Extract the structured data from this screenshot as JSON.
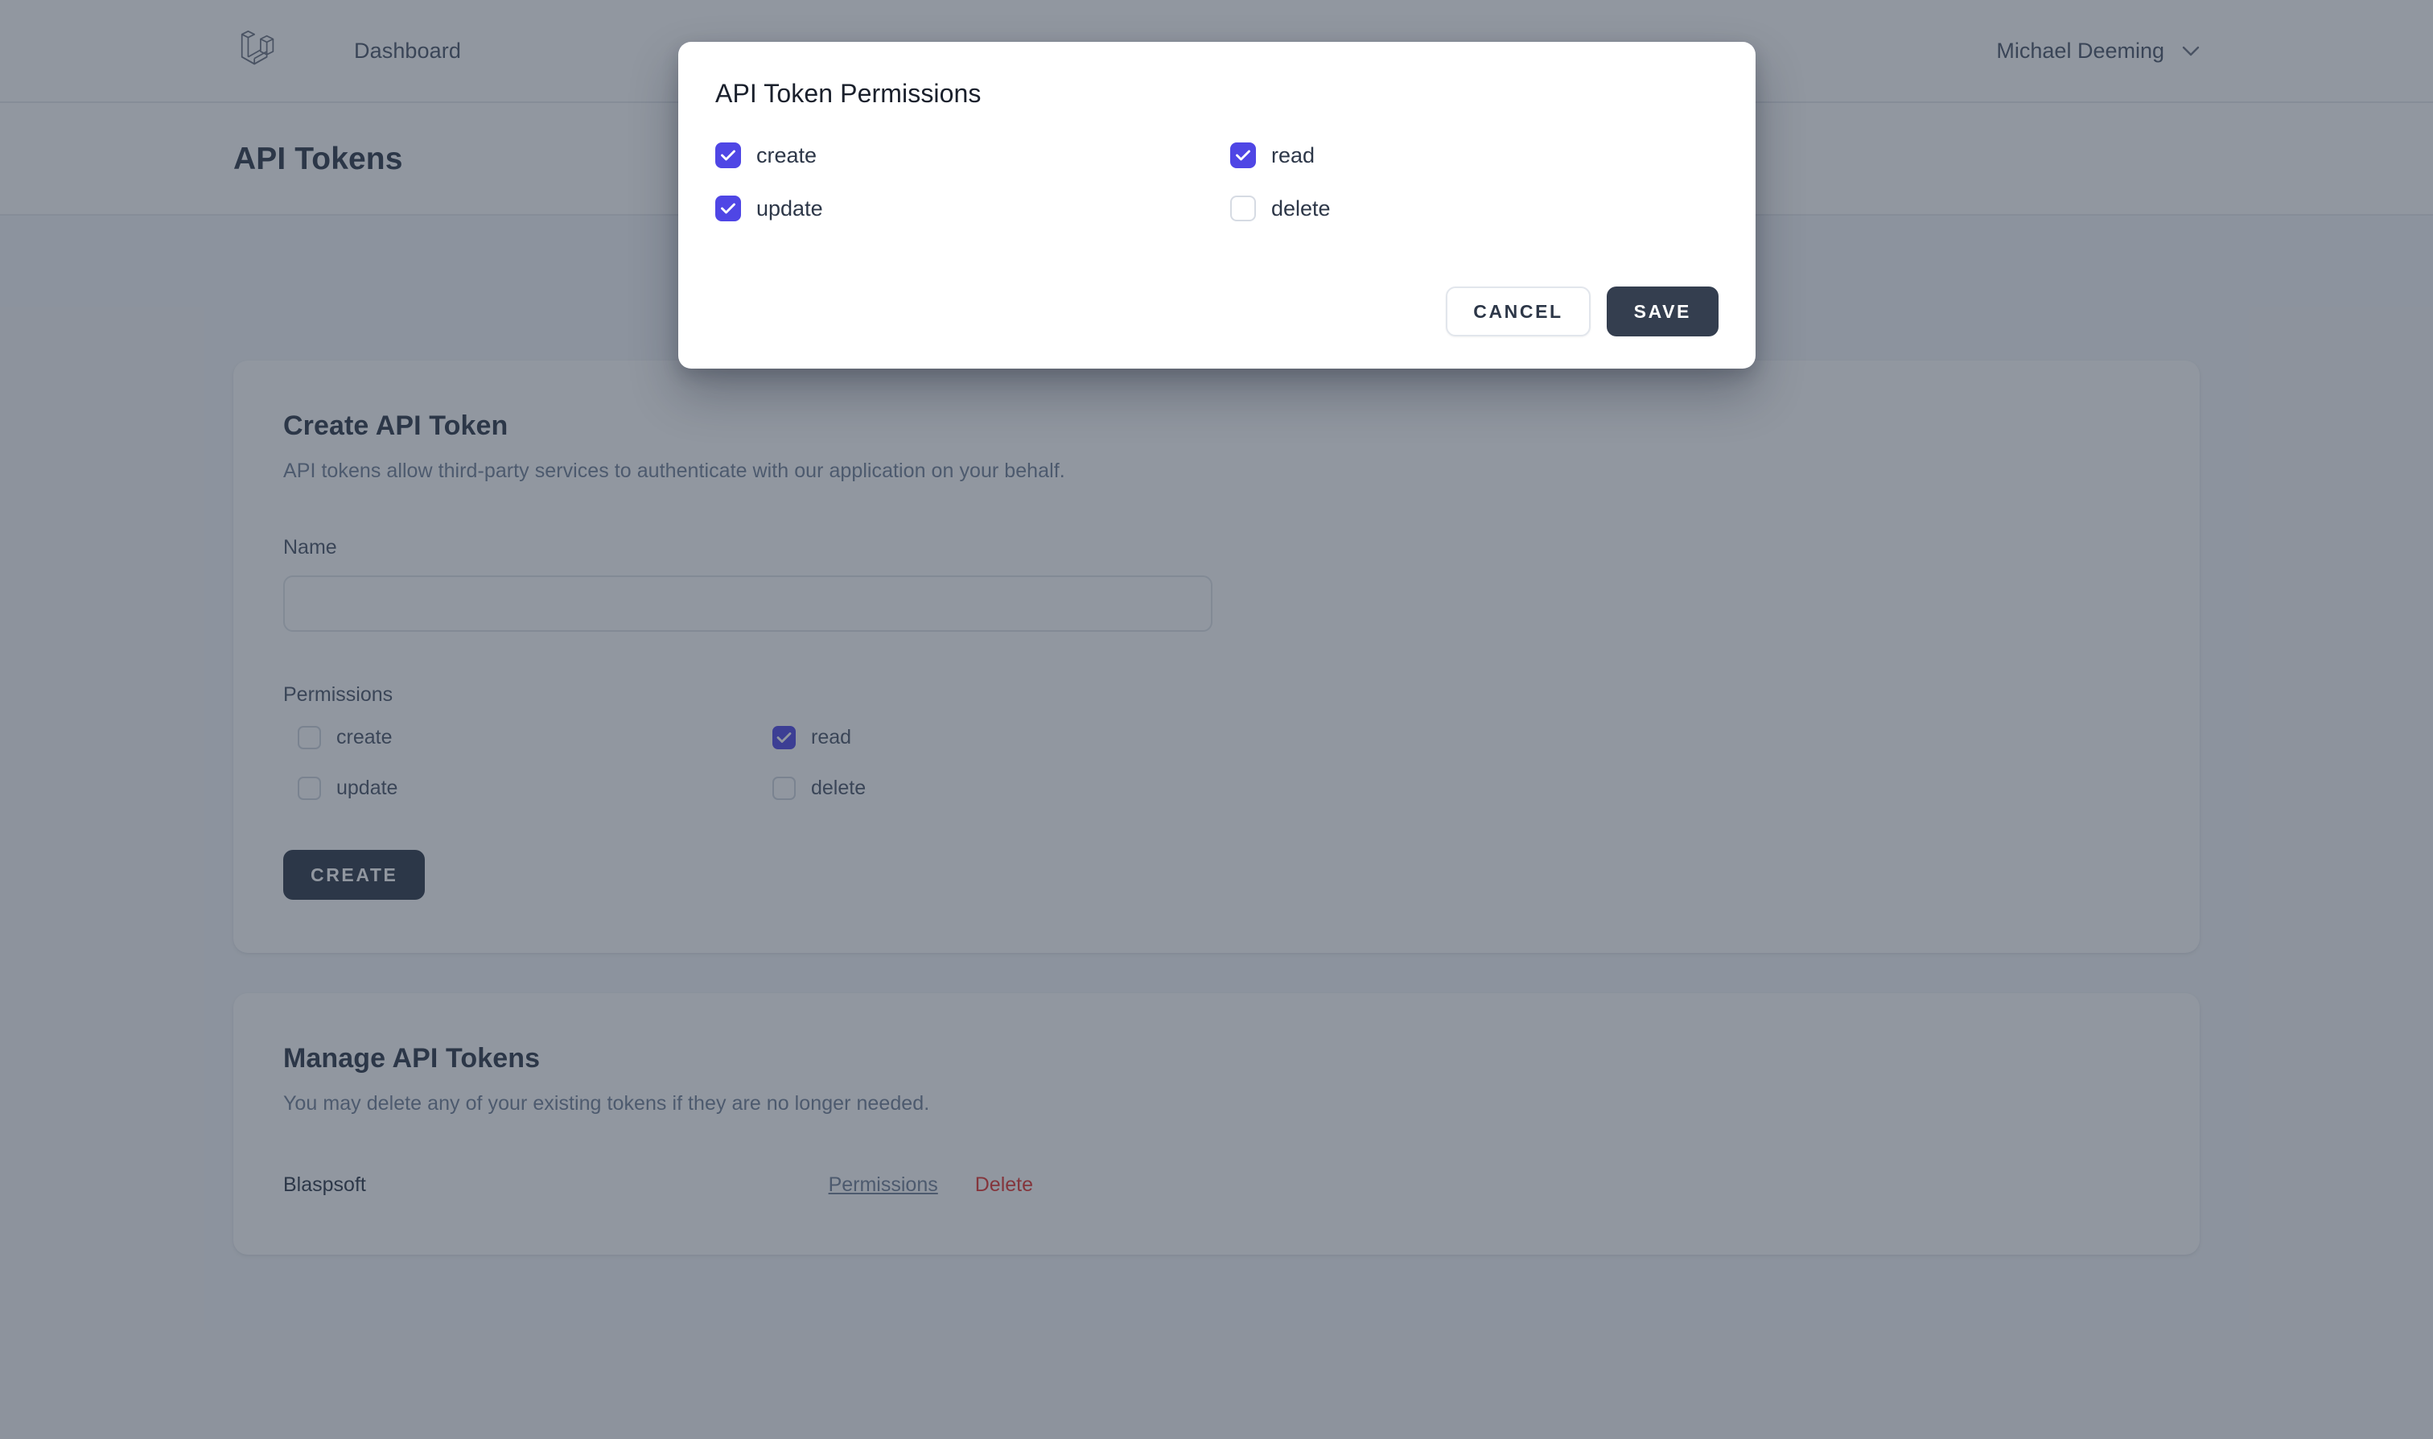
{
  "colors": {
    "accent_checkbox": "#4F46E5",
    "dark_button": "#343E4F",
    "delete_link": "#E3342F",
    "page_bg": "#F5F7FA",
    "overlay": "rgba(45,55,72,0.52)"
  },
  "navbar": {
    "logo_icon": "laravel-logo-icon",
    "links": [
      {
        "label": "Dashboard"
      }
    ],
    "user": {
      "name": "Michael Deeming",
      "chevron_icon": "chevron-down-icon"
    }
  },
  "page": {
    "title": "API Tokens"
  },
  "create_card": {
    "title": "Create API Token",
    "description": "API tokens allow third-party services to authenticate with our application on your behalf.",
    "name_label": "Name",
    "name_value": "",
    "name_placeholder": "",
    "permissions_label": "Permissions",
    "permissions": [
      {
        "label": "create",
        "checked": false
      },
      {
        "label": "read",
        "checked": true
      },
      {
        "label": "update",
        "checked": false
      },
      {
        "label": "delete",
        "checked": false
      }
    ],
    "create_button": "CREATE"
  },
  "manage_card": {
    "title": "Manage API Tokens",
    "description": "You may delete any of your existing tokens if they are no longer needed.",
    "tokens": [
      {
        "name": "Blaspsoft",
        "permissions_link": "Permissions",
        "delete_link": "Delete"
      }
    ]
  },
  "modal": {
    "title": "API Token Permissions",
    "permissions": [
      {
        "label": "create",
        "checked": true
      },
      {
        "label": "read",
        "checked": true
      },
      {
        "label": "update",
        "checked": true
      },
      {
        "label": "delete",
        "checked": false
      }
    ],
    "cancel_button": "CANCEL",
    "save_button": "SAVE"
  }
}
